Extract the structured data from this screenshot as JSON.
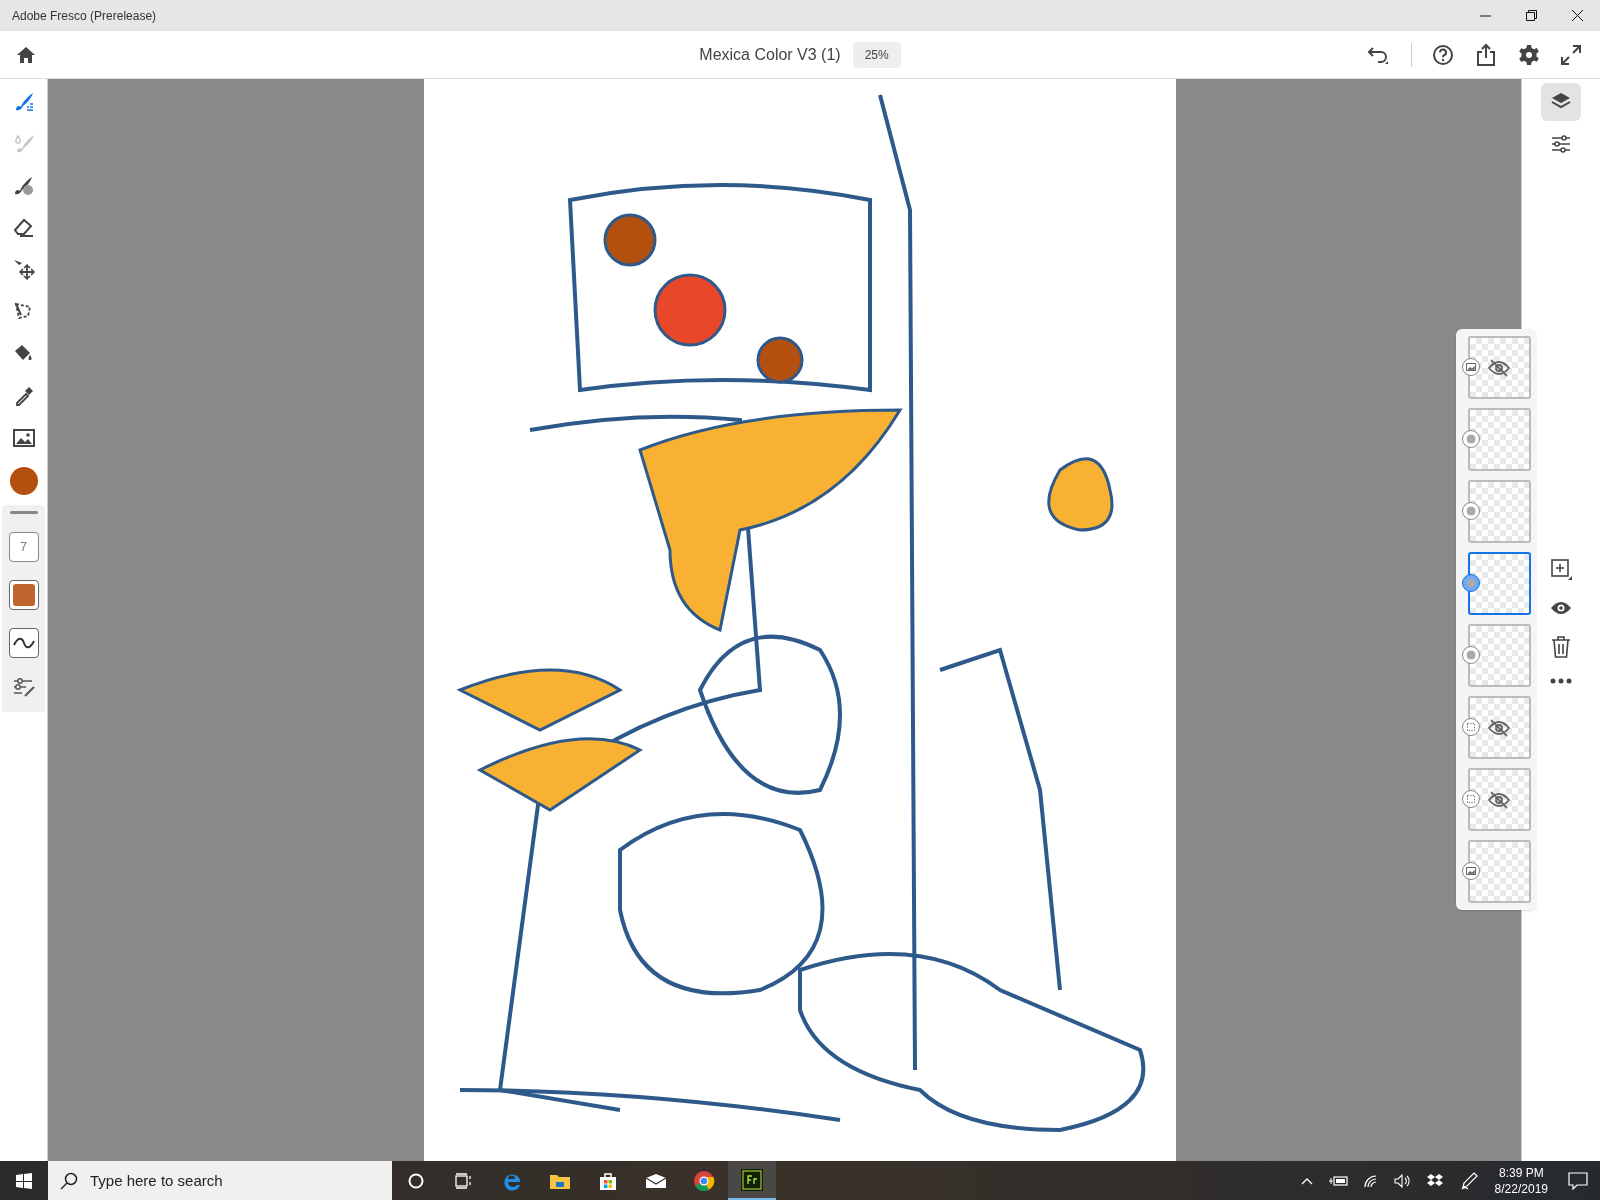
{
  "window": {
    "title": "Adobe Fresco (Prerelease)"
  },
  "header": {
    "document_title": "Mexica Color V3 (1)",
    "zoom": "25%"
  },
  "tools": [
    {
      "selected": true,
      "disabled": false
    },
    {
      "selected": false,
      "disabled": true
    },
    {
      "selected": false,
      "disabled": false
    },
    {
      "selected": false,
      "disabled": false
    },
    {
      "selected": false,
      "disabled": false
    },
    {
      "selected": false,
      "disabled": false
    },
    {
      "selected": false,
      "disabled": false
    },
    {
      "selected": false,
      "disabled": false
    },
    {
      "selected": false,
      "disabled": false
    }
  ],
  "current_color": {
    "color": "#b4500f"
  },
  "brush": {
    "size": "7",
    "color": "#c0652f"
  },
  "side_panel": [
    {
      "selected": true
    },
    {
      "selected": false
    }
  ],
  "layers": [
    {
      "kind": "image",
      "hidden": true,
      "selected": false
    },
    {
      "kind": "pixel",
      "hidden": false,
      "selected": false
    },
    {
      "kind": "pixel",
      "hidden": false,
      "selected": false
    },
    {
      "kind": "pixel",
      "hidden": false,
      "selected": true
    },
    {
      "kind": "pixel",
      "hidden": false,
      "selected": false
    },
    {
      "kind": "vector",
      "hidden": true,
      "selected": false
    },
    {
      "kind": "vector",
      "hidden": true,
      "selected": false
    },
    {
      "kind": "image",
      "hidden": false,
      "selected": false
    }
  ],
  "taskbar": {
    "search": {
      "placeholder": "Type here to search"
    },
    "time": "8:39 PM",
    "date": "8/22/2019"
  }
}
